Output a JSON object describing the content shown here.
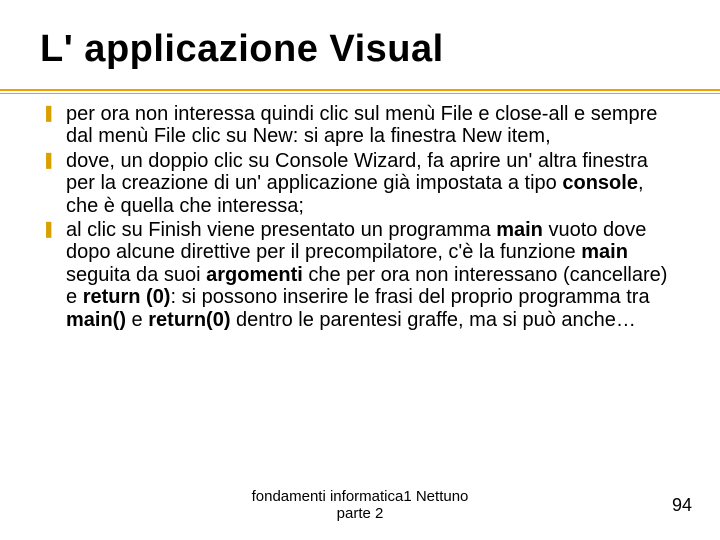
{
  "title": "L' applicazione Visual",
  "bullets": [
    {
      "pre": "per ora non interessa quindi clic sul menù File e close-all e sempre dal menù File clic su New: si apre la finestra New item,"
    },
    {
      "pre": " dove, un doppio clic su Console Wizard, fa aprire un' altra finestra per la creazione di un' applicazione già impostata a tipo ",
      "b1": "console",
      "post1": ", che è quella che interessa;"
    },
    {
      "pre": "al clic su Finish viene presentato un programma ",
      "b1": "main",
      "mid1": " vuoto dove dopo alcune direttive per il precompilatore, c'è la funzione ",
      "b2": "main",
      "mid2": " seguita da suoi ",
      "b3": "argomenti",
      "mid3": " che per ora non interessano (cancellare) e ",
      "b4": "return (0)",
      "mid4": ": si possono inserire le frasi del proprio programma tra ",
      "b5": "main()",
      "mid5": " e ",
      "b6": "return(0)",
      "post": " dentro le parentesi graffe, ma si può anche…"
    }
  ],
  "footer": {
    "line1": "fondamenti informatica1 Nettuno",
    "line2": "parte 2"
  },
  "page_number": "94"
}
